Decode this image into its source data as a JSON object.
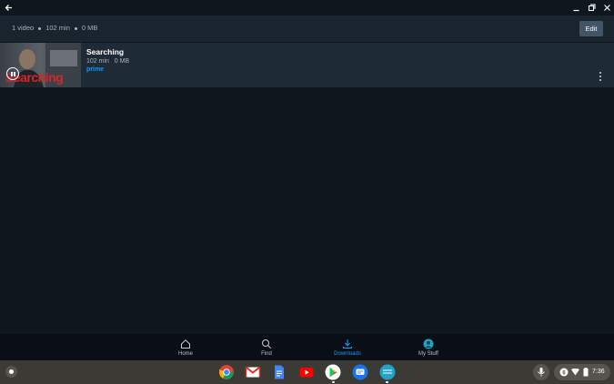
{
  "window": {
    "back_icon": "arrow-left-icon",
    "controls": [
      "minimize-icon",
      "restore-icon",
      "close-icon"
    ]
  },
  "summary": {
    "video_count": "1 video",
    "duration": "102 min",
    "size": "0 MB",
    "edit_label": "Edit"
  },
  "video": {
    "title": "Searching",
    "duration": "102 min",
    "size": "0 MB",
    "badge": "prime",
    "thumbnail_title": "Searching",
    "status_icon": "pause-circle-icon"
  },
  "nav": {
    "items": [
      {
        "label": "Home",
        "icon": "home-icon"
      },
      {
        "label": "Find",
        "icon": "search-icon"
      },
      {
        "label": "Downloads",
        "icon": "download-icon",
        "active": true
      },
      {
        "label": "My Stuff",
        "icon": "avatar-icon"
      }
    ]
  },
  "shelf": {
    "apps": [
      "chrome-icon",
      "gmail-icon",
      "docs-icon",
      "youtube-icon",
      "play-store-icon",
      "messages-icon",
      "prime-video-icon"
    ],
    "time": "7:36"
  },
  "colors": {
    "background": "#0f171e",
    "accent": "#1399ff",
    "row": "#1f2a37",
    "edit_button": "#425466"
  }
}
